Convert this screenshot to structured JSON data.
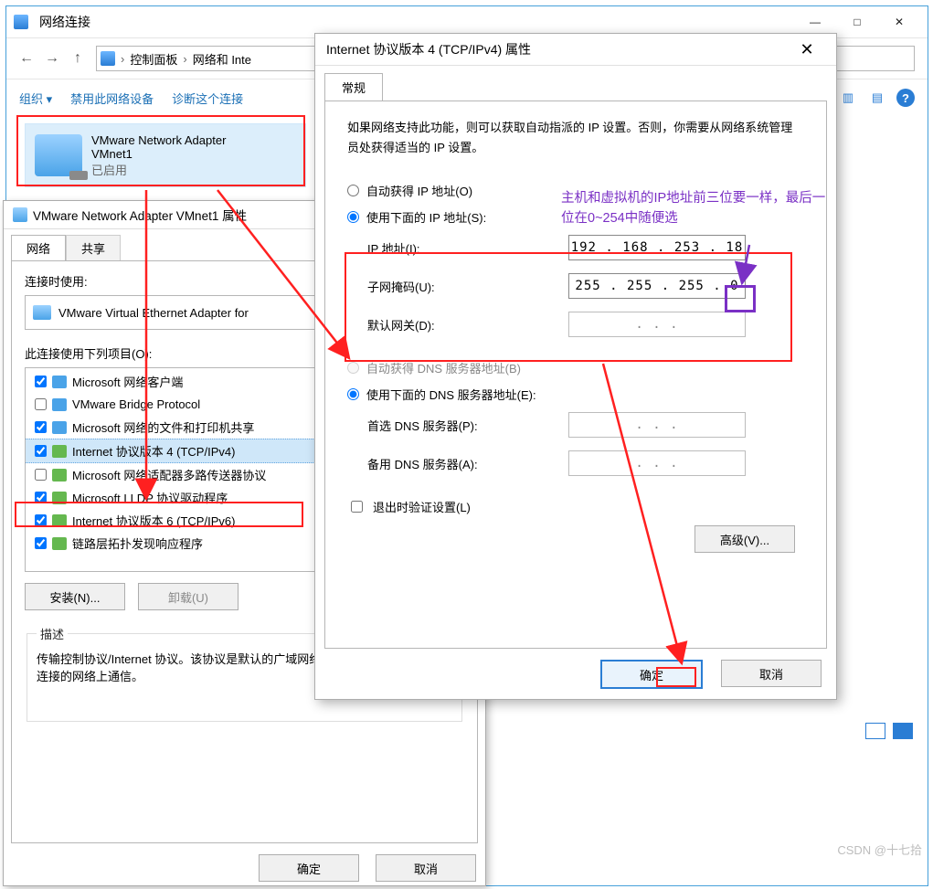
{
  "netwin": {
    "title": "网络连接",
    "breadcrumb": {
      "seg1": "控制面板",
      "seg2": "网络和 Inte"
    },
    "toolbar": {
      "organize": "组织 ▾",
      "disable": "禁用此网络设备",
      "diagnose": "诊断这个连接"
    },
    "adapter": {
      "name": "VMware Network Adapter",
      "name2": "VMnet1",
      "status": "已启用"
    }
  },
  "propwin": {
    "title": "VMware Network Adapter VMnet1 属性",
    "tabs": {
      "network": "网络",
      "sharing": "共享"
    },
    "connect_using_label": "连接时使用:",
    "connect_using_value": "VMware Virtual Ethernet Adapter for",
    "items_label": "此连接使用下列项目(O):",
    "items": [
      {
        "checked": true,
        "label": "Microsoft 网络客户端"
      },
      {
        "checked": false,
        "label": "VMware Bridge Protocol"
      },
      {
        "checked": true,
        "label": "Microsoft 网络的文件和打印机共享"
      },
      {
        "checked": true,
        "label": "Internet 协议版本 4 (TCP/IPv4)",
        "sel": true,
        "green": true
      },
      {
        "checked": false,
        "label": "Microsoft 网络适配器多路传送器协议",
        "green": true
      },
      {
        "checked": true,
        "label": "Microsoft LLDP 协议驱动程序",
        "green": true
      },
      {
        "checked": true,
        "label": "Internet 协议版本 6 (TCP/IPv6)",
        "green": true
      },
      {
        "checked": true,
        "label": "链路层拓扑发现响应程序",
        "green": true
      }
    ],
    "buttons": {
      "install": "安装(N)...",
      "uninstall": "卸载(U)"
    },
    "desc_label": "描述",
    "desc_text": "传输控制协议/Internet 协议。该协议是默认的广域网络协议，用于在不同的相互连接的网络上通信。",
    "ok": "确定",
    "cancel": "取消"
  },
  "ipv4": {
    "title": "Internet 协议版本 4 (TCP/IPv4) 属性",
    "tab": "常规",
    "blurb": "如果网络支持此功能，则可以获取自动指派的 IP 设置。否则，你需要从网络系统管理员处获得适当的 IP 设置。",
    "auto_ip": "自动获得 IP 地址(O)",
    "use_ip": "使用下面的 IP 地址(S):",
    "ip_label": "IP 地址(I):",
    "ip_value": "192 . 168 . 253 .  18",
    "subnet_label": "子网掩码(U):",
    "subnet_value": "255 . 255 . 255 .  0",
    "gateway_label": "默认网关(D):",
    "gateway_value": ".        .        .",
    "auto_dns": "自动获得 DNS 服务器地址(B)",
    "use_dns": "使用下面的 DNS 服务器地址(E):",
    "pref_dns_label": "首选 DNS 服务器(P):",
    "pref_dns_value": ".        .        .",
    "alt_dns_label": "备用 DNS 服务器(A):",
    "alt_dns_value": ".        .        .",
    "validate": "退出时验证设置(L)",
    "advanced": "高级(V)...",
    "ok": "确定",
    "cancel": "取消"
  },
  "annotation": "主机和虚拟机的IP地址前三位要一样，最后一位在0~254中随便选",
  "watermark": "CSDN @十七拾"
}
